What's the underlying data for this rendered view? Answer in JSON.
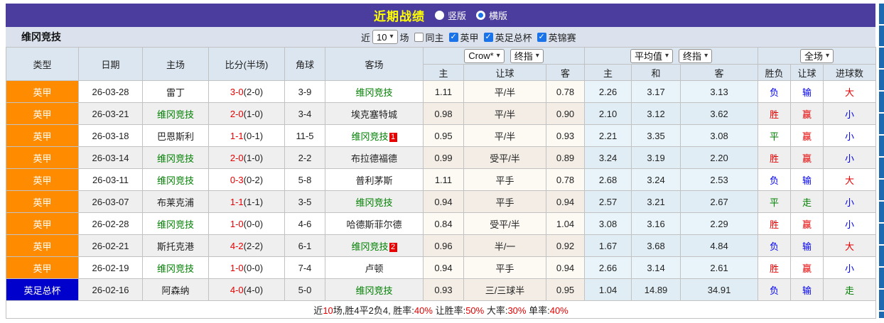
{
  "colors": {
    "topbar_bg": "#4a3d9e",
    "title": "#ffff00",
    "filter_bg": "#dbe2ee",
    "header_bg": "#dce6f0",
    "league_one_bg": "#ff8c00",
    "fa_cup_bg": "#0000cc",
    "team_green": "#008000",
    "win_red": "#e60000",
    "draw_green": "#008000",
    "lose_blue": "#0000ee",
    "edge_strip": "#1e6ab0"
  },
  "topbar": {
    "title": "近期战绩",
    "radios": [
      {
        "label": "竖版",
        "selected": false
      },
      {
        "label": "横版",
        "selected": true
      }
    ]
  },
  "filter": {
    "team": "维冈竞技",
    "near_label": "近",
    "count": "10",
    "games_label": "场",
    "checkboxes": [
      {
        "label": "同主",
        "checked": false
      },
      {
        "label": "英甲",
        "checked": true
      },
      {
        "label": "英足总杯",
        "checked": true
      },
      {
        "label": "英锦赛",
        "checked": true
      }
    ]
  },
  "table": {
    "left_headers": [
      "类型",
      "日期",
      "主场",
      "比分(半场)",
      "角球",
      "客场"
    ],
    "selects": {
      "crow": "Crow*",
      "final1": "终指",
      "avg": "平均值",
      "final2": "终指",
      "scope": "全场"
    },
    "sub_headers": [
      "主",
      "让球",
      "客",
      "主",
      "和",
      "客",
      "胜负",
      "让球",
      "进球数"
    ],
    "rows": [
      {
        "league": "英甲",
        "league_bg": "#ff8c00",
        "date": "26-03-28",
        "home": "雷丁",
        "home_is_team": false,
        "score": "3-0",
        "half": "(2-0)",
        "corner": "3-9",
        "away": "维冈竞技",
        "away_is_team": true,
        "away_badge": "",
        "crow": [
          "1.11",
          "平/半",
          "0.78"
        ],
        "avg": [
          "2.26",
          "3.17",
          "3.13"
        ],
        "results": [
          {
            "text": "负",
            "color": "blue"
          },
          {
            "text": "输",
            "color": "blue"
          },
          {
            "text": "大",
            "color": "red"
          }
        ]
      },
      {
        "league": "英甲",
        "league_bg": "#ff8c00",
        "date": "26-03-21",
        "home": "维冈竞技",
        "home_is_team": true,
        "score": "2-0",
        "half": "(1-0)",
        "corner": "3-4",
        "away": "埃克塞特城",
        "away_is_team": false,
        "away_badge": "",
        "crow": [
          "0.98",
          "平/半",
          "0.90"
        ],
        "avg": [
          "2.10",
          "3.12",
          "3.62"
        ],
        "results": [
          {
            "text": "胜",
            "color": "red"
          },
          {
            "text": "赢",
            "color": "red"
          },
          {
            "text": "小",
            "color": "blue"
          }
        ]
      },
      {
        "league": "英甲",
        "league_bg": "#ff8c00",
        "date": "26-03-18",
        "home": "巴恩斯利",
        "home_is_team": false,
        "score": "1-1",
        "half": "(0-1)",
        "corner": "11-5",
        "away": "维冈竞技",
        "away_is_team": true,
        "away_badge": "1",
        "crow": [
          "0.95",
          "平/半",
          "0.93"
        ],
        "avg": [
          "2.21",
          "3.35",
          "3.08"
        ],
        "results": [
          {
            "text": "平",
            "color": "green"
          },
          {
            "text": "赢",
            "color": "red"
          },
          {
            "text": "小",
            "color": "blue"
          }
        ]
      },
      {
        "league": "英甲",
        "league_bg": "#ff8c00",
        "date": "26-03-14",
        "home": "维冈竞技",
        "home_is_team": true,
        "score": "2-0",
        "half": "(1-0)",
        "corner": "2-2",
        "away": "布拉德福德",
        "away_is_team": false,
        "away_badge": "",
        "crow": [
          "0.99",
          "受平/半",
          "0.89"
        ],
        "avg": [
          "3.24",
          "3.19",
          "2.20"
        ],
        "results": [
          {
            "text": "胜",
            "color": "red"
          },
          {
            "text": "赢",
            "color": "red"
          },
          {
            "text": "小",
            "color": "blue"
          }
        ]
      },
      {
        "league": "英甲",
        "league_bg": "#ff8c00",
        "date": "26-03-11",
        "home": "维冈竞技",
        "home_is_team": true,
        "score": "0-3",
        "half": "(0-2)",
        "corner": "5-8",
        "away": "普利茅斯",
        "away_is_team": false,
        "away_badge": "",
        "crow": [
          "1.11",
          "平手",
          "0.78"
        ],
        "avg": [
          "2.68",
          "3.24",
          "2.53"
        ],
        "results": [
          {
            "text": "负",
            "color": "blue"
          },
          {
            "text": "输",
            "color": "blue"
          },
          {
            "text": "大",
            "color": "red"
          }
        ]
      },
      {
        "league": "英甲",
        "league_bg": "#ff8c00",
        "date": "26-03-07",
        "home": "布莱克浦",
        "home_is_team": false,
        "score": "1-1",
        "half": "(1-1)",
        "corner": "3-5",
        "away": "维冈竞技",
        "away_is_team": true,
        "away_badge": "",
        "crow": [
          "0.94",
          "平手",
          "0.94"
        ],
        "avg": [
          "2.57",
          "3.21",
          "2.67"
        ],
        "results": [
          {
            "text": "平",
            "color": "green"
          },
          {
            "text": "走",
            "color": "green"
          },
          {
            "text": "小",
            "color": "blue"
          }
        ]
      },
      {
        "league": "英甲",
        "league_bg": "#ff8c00",
        "date": "26-02-28",
        "home": "维冈竞技",
        "home_is_team": true,
        "score": "1-0",
        "half": "(0-0)",
        "corner": "4-6",
        "away": "哈德斯菲尔德",
        "away_is_team": false,
        "away_badge": "",
        "crow": [
          "0.84",
          "受平/半",
          "1.04"
        ],
        "avg": [
          "3.08",
          "3.16",
          "2.29"
        ],
        "results": [
          {
            "text": "胜",
            "color": "red"
          },
          {
            "text": "赢",
            "color": "red"
          },
          {
            "text": "小",
            "color": "blue"
          }
        ]
      },
      {
        "league": "英甲",
        "league_bg": "#ff8c00",
        "date": "26-02-21",
        "home": "斯托克港",
        "home_is_team": false,
        "score": "4-2",
        "half": "(2-2)",
        "corner": "6-1",
        "away": "维冈竞技",
        "away_is_team": true,
        "away_badge": "2",
        "crow": [
          "0.96",
          "半/一",
          "0.92"
        ],
        "avg": [
          "1.67",
          "3.68",
          "4.84"
        ],
        "results": [
          {
            "text": "负",
            "color": "blue"
          },
          {
            "text": "输",
            "color": "blue"
          },
          {
            "text": "大",
            "color": "red"
          }
        ]
      },
      {
        "league": "英甲",
        "league_bg": "#ff8c00",
        "date": "26-02-19",
        "home": "维冈竞技",
        "home_is_team": true,
        "score": "1-0",
        "half": "(0-0)",
        "corner": "7-4",
        "away": "卢顿",
        "away_is_team": false,
        "away_badge": "",
        "crow": [
          "0.94",
          "平手",
          "0.94"
        ],
        "avg": [
          "2.66",
          "3.14",
          "2.61"
        ],
        "results": [
          {
            "text": "胜",
            "color": "red"
          },
          {
            "text": "赢",
            "color": "red"
          },
          {
            "text": "小",
            "color": "blue"
          }
        ]
      },
      {
        "league": "英足总杯",
        "league_bg": "#0000cc",
        "date": "26-02-16",
        "home": "阿森纳",
        "home_is_team": false,
        "score": "4-0",
        "half": "(4-0)",
        "corner": "5-0",
        "away": "维冈竞技",
        "away_is_team": true,
        "away_badge": "",
        "crow": [
          "0.93",
          "三/三球半",
          "0.95"
        ],
        "avg": [
          "1.04",
          "14.89",
          "34.91"
        ],
        "results": [
          {
            "text": "负",
            "color": "blue"
          },
          {
            "text": "输",
            "color": "blue"
          },
          {
            "text": "走",
            "color": "green"
          }
        ]
      }
    ],
    "footer_segments": [
      {
        "text": "近",
        "color": "black"
      },
      {
        "text": "10",
        "color": "red"
      },
      {
        "text": "场,胜4平2负4, 胜率:",
        "color": "black"
      },
      {
        "text": "40%",
        "color": "red"
      },
      {
        "text": " 让胜率:",
        "color": "black"
      },
      {
        "text": "50%",
        "color": "red"
      },
      {
        "text": " 大率:",
        "color": "black"
      },
      {
        "text": "30%",
        "color": "red"
      },
      {
        "text": " 单率:",
        "color": "black"
      },
      {
        "text": "40%",
        "color": "red"
      }
    ]
  }
}
